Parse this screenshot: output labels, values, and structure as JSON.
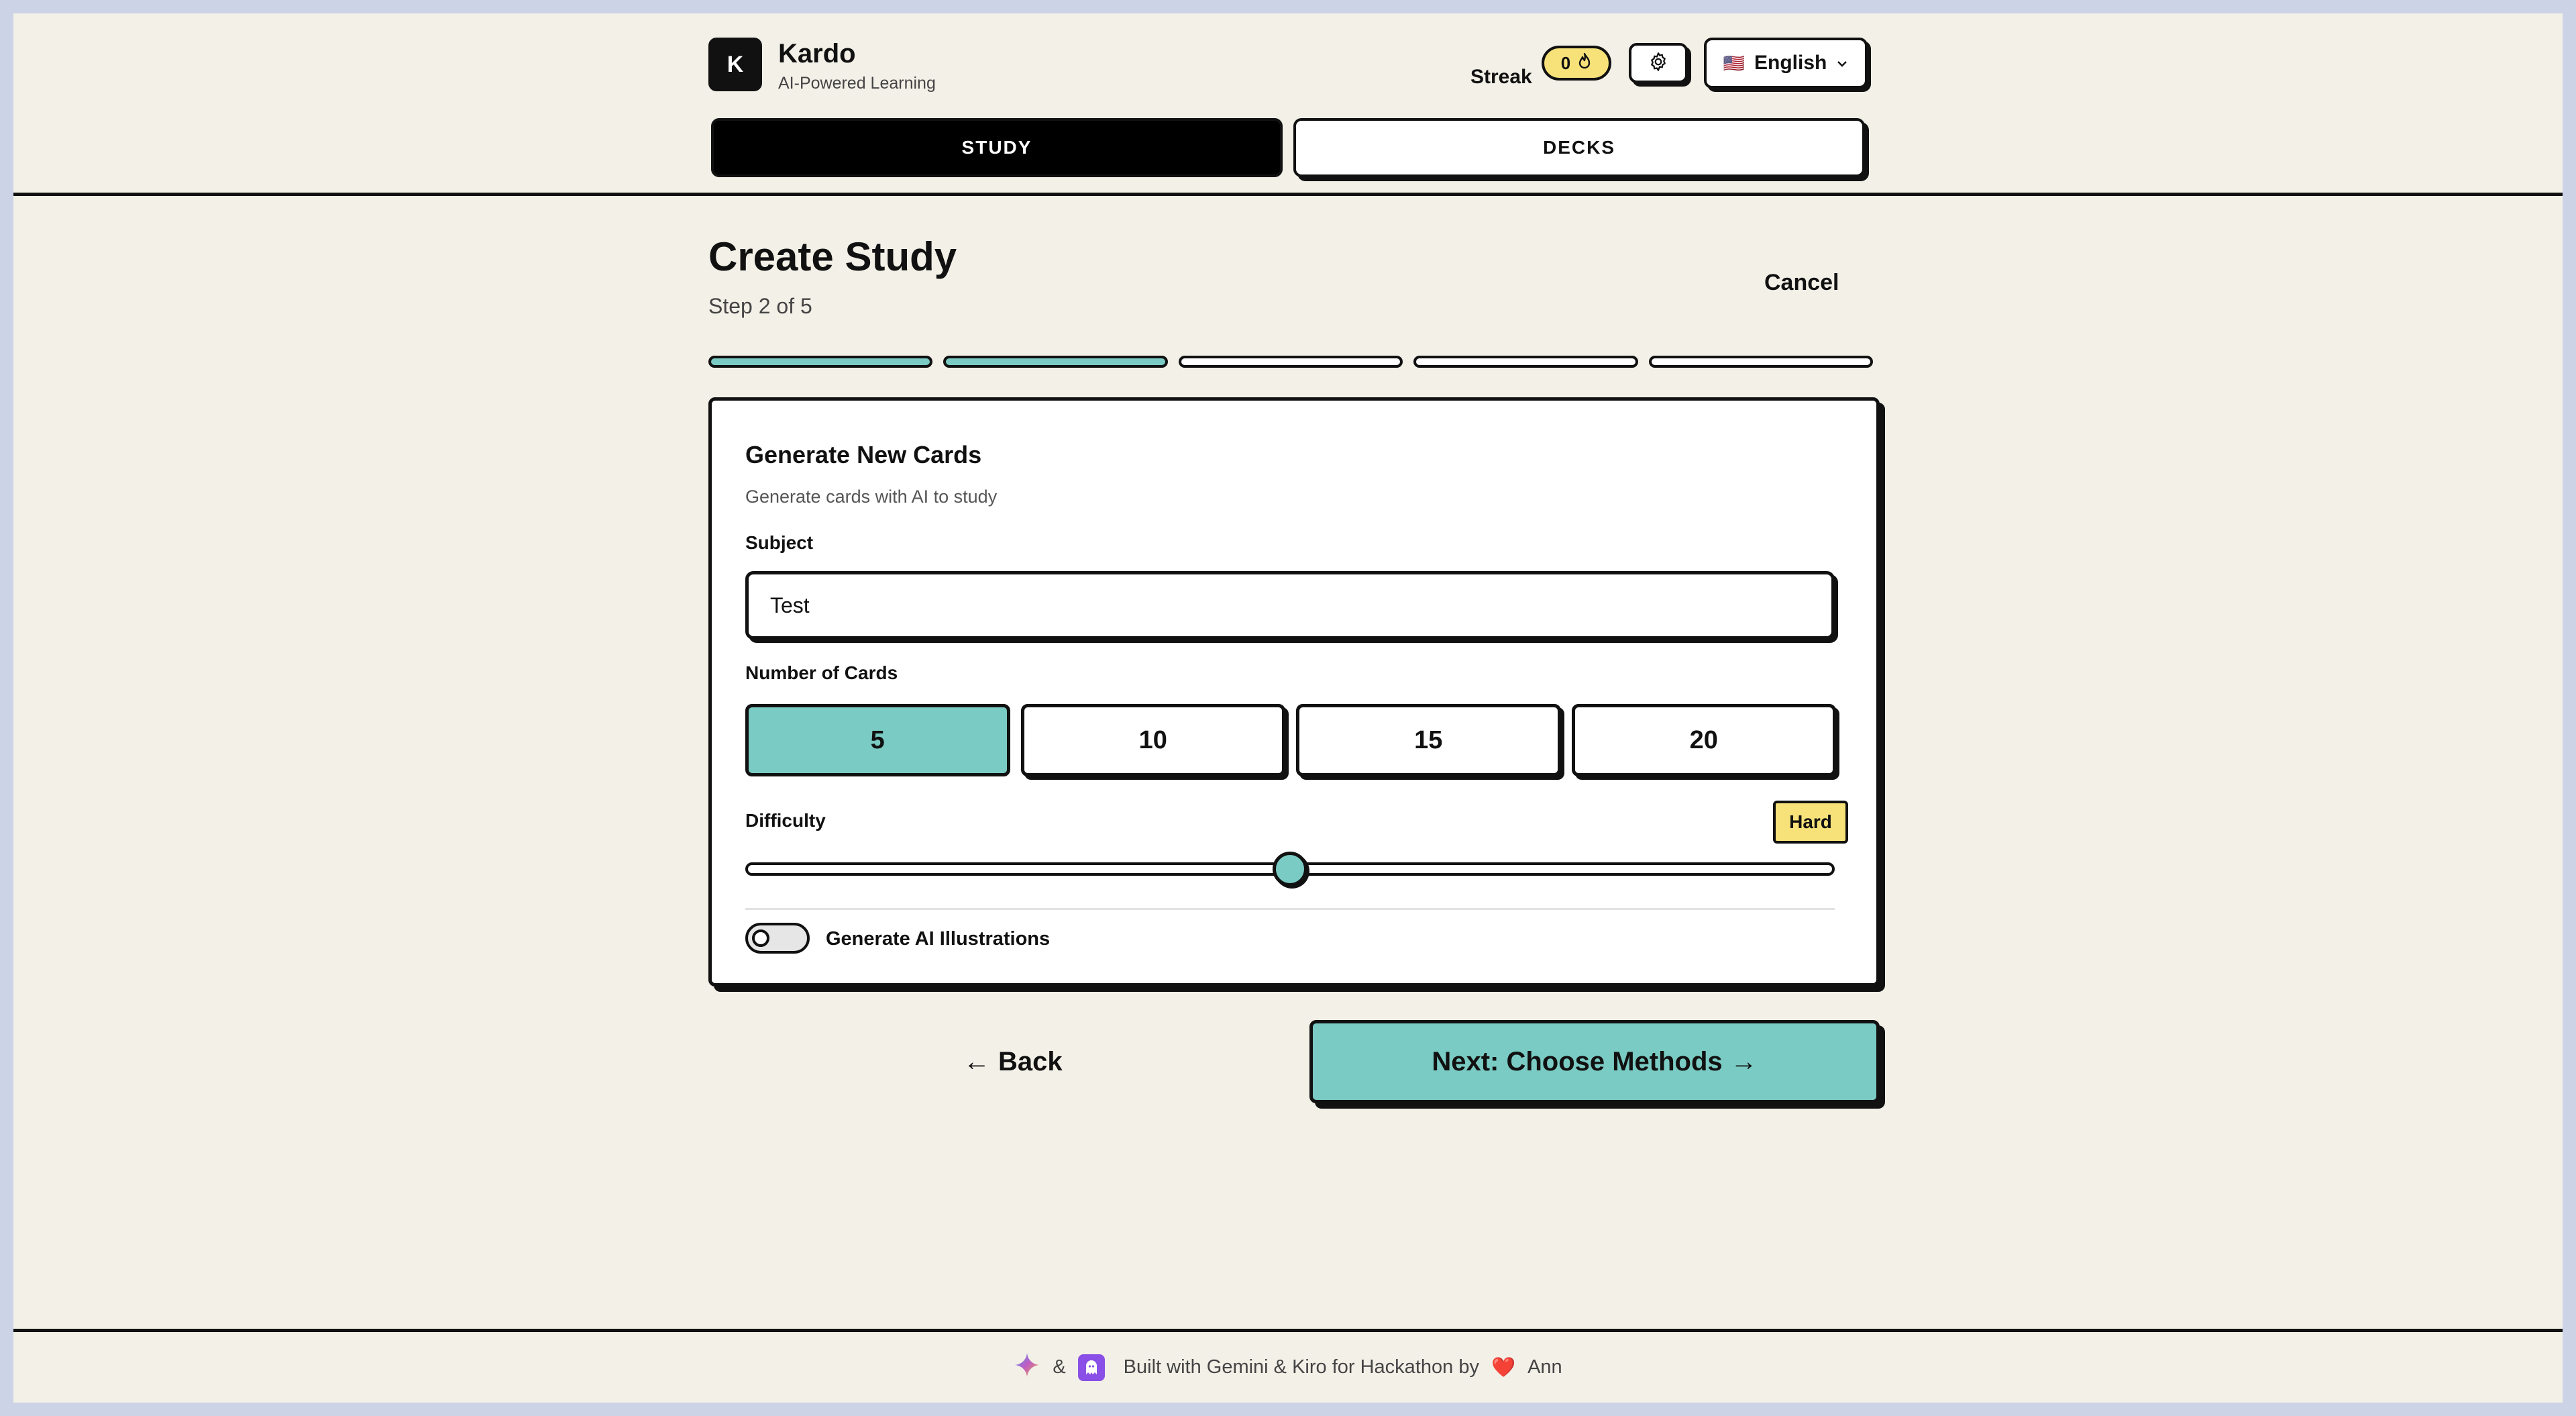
{
  "app": {
    "logo_letter": "K",
    "title": "Kardo",
    "subtitle": "AI-Powered Learning"
  },
  "header": {
    "streak_label": "Streak",
    "streak_count": "0",
    "streak_icon": "flame-icon",
    "settings_icon": "gear-icon",
    "language": {
      "flag": "🇺🇸",
      "label": "English",
      "icon": "chevron-down-icon"
    }
  },
  "tabs": [
    {
      "label": "STUDY",
      "active": true
    },
    {
      "label": "DECKS",
      "active": false
    }
  ],
  "page": {
    "title": "Create Study",
    "step": "Step 2 of 5",
    "cancel": "Cancel",
    "steps_total": 5,
    "steps_done": 2
  },
  "form": {
    "title": "Generate New Cards",
    "description": "Generate cards with AI to study",
    "subject_label": "Subject",
    "subject_value": "Test",
    "count_label": "Number of Cards",
    "count_options": [
      "5",
      "10",
      "15",
      "20"
    ],
    "count_selected": "5",
    "difficulty_label": "Difficulty",
    "difficulty_value": "Hard",
    "difficulty_level": 0.5,
    "illustrations_label": "Generate AI Illustrations",
    "illustrations_enabled": false
  },
  "actions": {
    "back_arrow": "←",
    "back": "Back",
    "next": "Next: Choose Methods",
    "next_arrow": "→"
  },
  "footer": {
    "amp": "&",
    "text": "Built with Gemini & Kiro for Hackathon by",
    "heart": "❤️",
    "author": "Ann",
    "icons": [
      "gemini-sparkle-icon",
      "kiro-ghost-icon"
    ]
  },
  "colors": {
    "background": "#f3f0e8",
    "accent": "#7acbc3",
    "highlight": "#f7e27a",
    "ink": "#111111"
  }
}
